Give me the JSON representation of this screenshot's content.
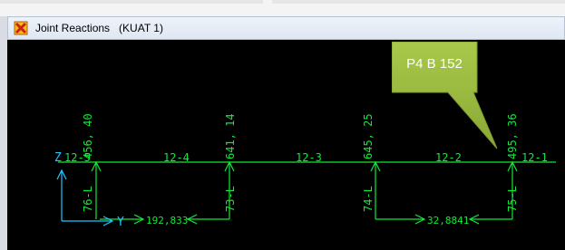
{
  "window": {
    "title": "Joint Reactions   (KUAT 1)"
  },
  "colors": {
    "green": "#12e838",
    "cyan": "#1ec8ff",
    "callout": "#93b53c",
    "title_icon": "#e26a1a"
  },
  "callout": {
    "text": "P4 B 152"
  },
  "diagram": {
    "members": [
      "12-5",
      "12-4",
      "12-3",
      "12-2",
      "12-1"
    ],
    "reactions": [
      {
        "vertical": "456, 40",
        "member_text": "76-L"
      },
      {
        "vertical": "641, 14",
        "member_text": "73-L"
      },
      {
        "vertical": "645, 25",
        "member_text": "74-L"
      },
      {
        "vertical": "495, 36",
        "member_text": "75-L"
      }
    ],
    "horizontal_forces": [
      "192,833",
      "32,8841"
    ],
    "axes": {
      "z": "Z",
      "y": "Y"
    }
  }
}
